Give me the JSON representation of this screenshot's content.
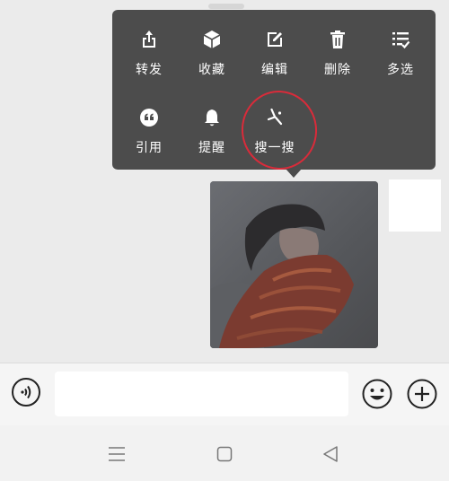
{
  "context_menu": {
    "row1": [
      {
        "label": "转发",
        "icon": "share-icon"
      },
      {
        "label": "收藏",
        "icon": "favorite-cube-icon"
      },
      {
        "label": "编辑",
        "icon": "edit-icon"
      },
      {
        "label": "删除",
        "icon": "trash-icon"
      },
      {
        "label": "多选",
        "icon": "multi-select-icon"
      }
    ],
    "row2": [
      {
        "label": "引用",
        "icon": "quote-icon"
      },
      {
        "label": "提醒",
        "icon": "bell-icon"
      },
      {
        "label": "搜一搜",
        "icon": "search-spark-icon"
      }
    ]
  },
  "colors": {
    "menu_bg": "#4c4c4c",
    "annotation": "#d92b3a",
    "chat_bg": "#ebebeb"
  },
  "input_bar": {
    "text_value": "",
    "voice_icon": "voice-icon",
    "emoji_icon": "emoji-icon",
    "add_icon": "add-icon"
  },
  "nav_bar": {
    "icons": [
      "menu-icon",
      "home-square-icon",
      "back-triangle-icon"
    ]
  }
}
